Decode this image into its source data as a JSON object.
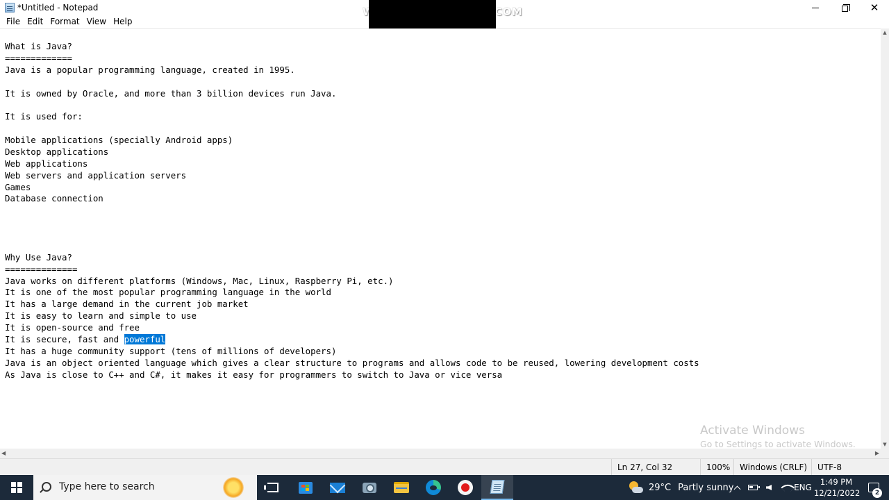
{
  "window": {
    "title": "*Untitled - Notepad",
    "watermark_left": "W",
    "watermark_right": "COM"
  },
  "menu": [
    "File",
    "Edit",
    "Format",
    "View",
    "Help"
  ],
  "editor": {
    "lines": [
      "What is Java?",
      "=============",
      "Java is a popular programming language, created in 1995.",
      "",
      "It is owned by Oracle, and more than 3 billion devices run Java.",
      "",
      "It is used for:",
      "",
      "Mobile applications (specially Android apps)",
      "Desktop applications",
      "Web applications",
      "Web servers and application servers",
      "Games",
      "Database connection",
      "",
      "",
      "",
      "",
      "Why Use Java?",
      "==============",
      "Java works on different platforms (Windows, Mac, Linux, Raspberry Pi, etc.)",
      "It is one of the most popular programming language in the world",
      "It has a large demand in the current job market",
      "It is easy to learn and simple to use",
      "It is open-source and free",
      "It is secure, fast and powerful",
      "It has a huge community support (tens of millions of developers)",
      "Java is an object oriented language which gives a clear structure to programs and allows code to be reused, lowering development costs",
      "As Java is close to C++ and C#, it makes it easy for programmers to switch to Java or vice versa"
    ],
    "selected_line": 25,
    "selected_prefix": "It is secure, fast and ",
    "selected_text": "powerful"
  },
  "activation": {
    "title": "Activate Windows",
    "subtitle": "Go to Settings to activate Windows."
  },
  "status": {
    "position": "Ln 27, Col 32",
    "zoom": "100%",
    "line_ending": "Windows (CRLF)",
    "encoding": "UTF-8"
  },
  "taskbar": {
    "search_placeholder": "Type here to search",
    "weather_temp": "29°C",
    "weather_desc": "Partly sunny",
    "language": "ENG",
    "time": "1:49 PM",
    "date": "12/21/2022",
    "notification_count": "2"
  },
  "colors": {
    "selection": "#0078d7",
    "taskbar_bg": "#1c2a3a"
  }
}
